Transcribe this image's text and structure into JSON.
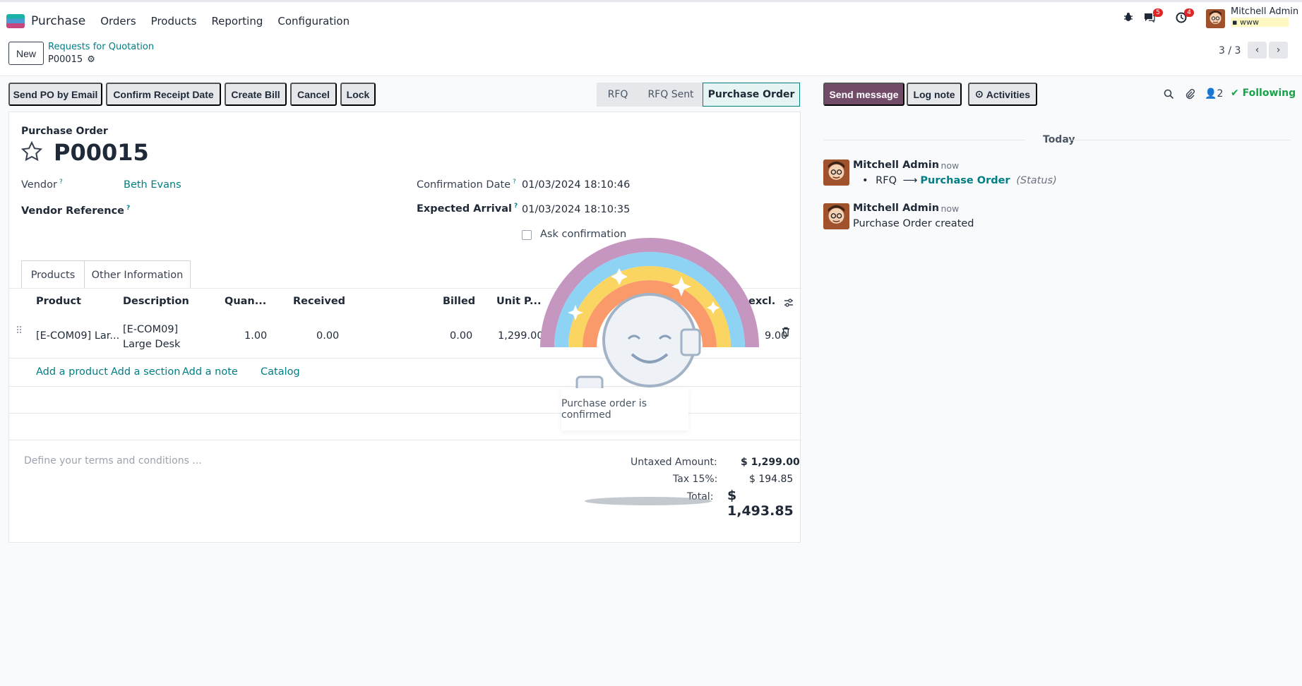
{
  "nav": {
    "app_name": "Purchase",
    "menu": [
      "Orders",
      "Products",
      "Reporting",
      "Configuration"
    ],
    "messages_count": "5",
    "activities_count": "4",
    "user_name": "Mitchell Admin",
    "db_name": "www"
  },
  "control": {
    "new_label": "New",
    "breadcrumb_parent": "Requests for Quotation",
    "breadcrumb_current": "P00015",
    "pager": "3 / 3"
  },
  "actions": [
    "Send PO by Email",
    "Confirm Receipt Date",
    "Create Bill",
    "Cancel",
    "Lock"
  ],
  "stages": [
    "RFQ",
    "RFQ Sent",
    "Purchase Order"
  ],
  "form": {
    "doc_type": "Purchase Order",
    "name": "P00015",
    "vendor_label": "Vendor",
    "vendor_value": "Beth Evans",
    "vendor_ref_label": "Vendor Reference",
    "confirmation_label": "Confirmation Date",
    "confirmation_value": "01/03/2024 18:10:46",
    "arrival_label": "Expected Arrival",
    "arrival_value": "01/03/2024 18:10:35",
    "ask_confirmation": "Ask confirmation",
    "help_mark": "?",
    "tabs": [
      "Products",
      "Other Information"
    ],
    "columns": [
      "Product",
      "Description",
      "Quan...",
      "Received",
      "Billed",
      "Unit P...",
      "excl."
    ],
    "line": {
      "product": "[E-COM09] Lar...",
      "description_1": "[E-COM09]",
      "description_2": "Large Desk",
      "quantity": "1.00",
      "received": "0.00",
      "billed": "0.00",
      "unit_price": "1,299.00",
      "subtotal": "9.00"
    },
    "add_links": [
      "Add a product",
      "Add a section",
      "Add a note",
      "Catalog"
    ],
    "terms_placeholder": "Define your terms and conditions ...",
    "totals": {
      "untaxed_label": "Untaxed Amount:",
      "untaxed_value": "$ 1,299.00",
      "tax_label": "Tax 15%:",
      "tax_value": "$ 194.85",
      "total_label": "Total:",
      "total_value": "$ 1,493.85"
    }
  },
  "rainbow": {
    "message": "Purchase order is confirmed"
  },
  "chatter": {
    "send_message": "Send message",
    "log_note": "Log note",
    "activities": "Activities",
    "followers_count": "2",
    "following": "Following",
    "day_separator": "Today",
    "messages": [
      {
        "author": "Mitchell Admin",
        "time": "- now",
        "from": "RFQ",
        "to": "Purchase Order",
        "field": "(Status)"
      },
      {
        "author": "Mitchell Admin",
        "time": "- now",
        "body": "Purchase Order created"
      }
    ]
  },
  "colors": {
    "brand": "#714b67",
    "link": "#017e84",
    "badge": "#dc2626"
  }
}
